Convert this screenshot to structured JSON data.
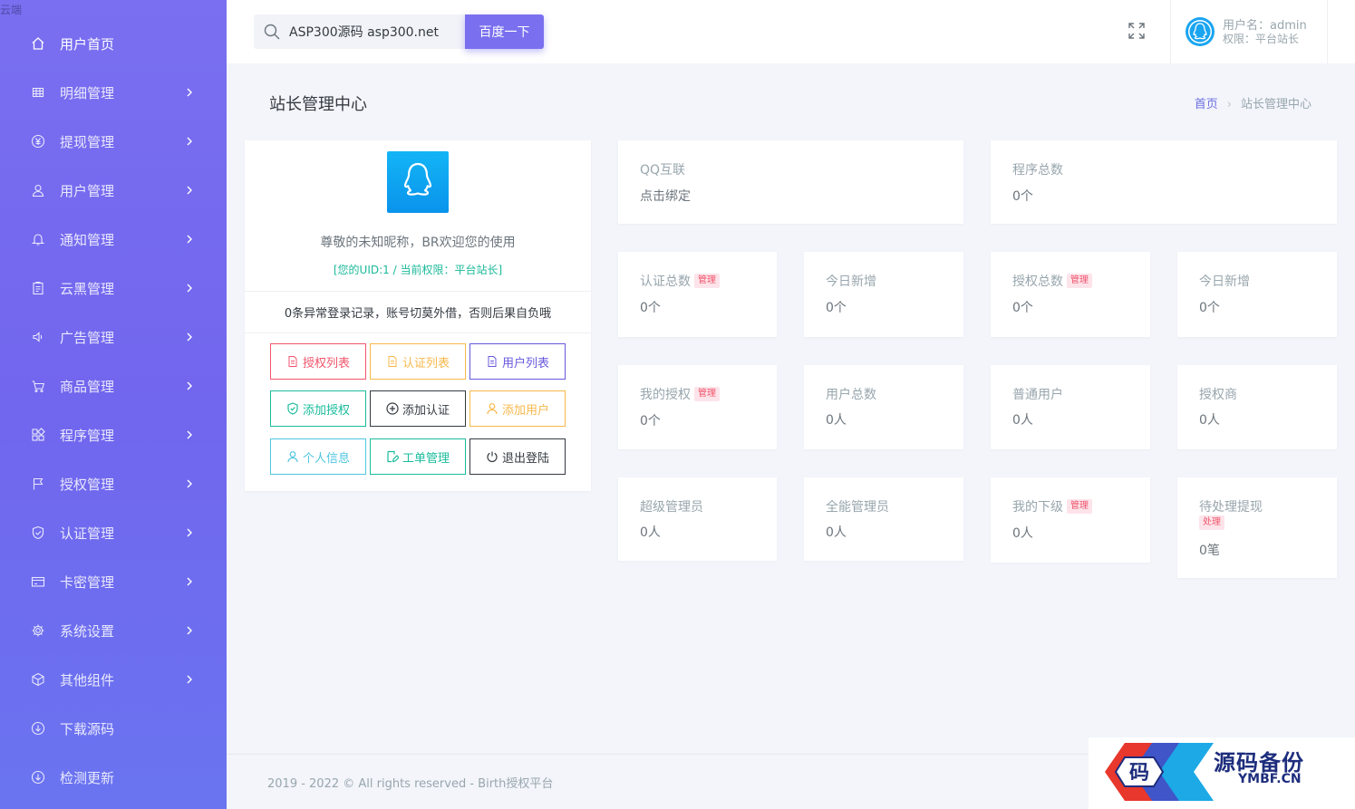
{
  "site_name": "云端",
  "sidebar": {
    "items": [
      {
        "label": "用户首页",
        "icon": "home-icon"
      },
      {
        "label": "明细管理",
        "icon": "grid-icon"
      },
      {
        "label": "提现管理",
        "icon": "yen-icon"
      },
      {
        "label": "用户管理",
        "icon": "user-icon"
      },
      {
        "label": "通知管理",
        "icon": "bell-icon"
      },
      {
        "label": "云黑管理",
        "icon": "clipboard-icon"
      },
      {
        "label": "广告管理",
        "icon": "speaker-icon"
      },
      {
        "label": "商品管理",
        "icon": "cart-icon"
      },
      {
        "label": "程序管理",
        "icon": "apps-icon"
      },
      {
        "label": "授权管理",
        "icon": "flag-icon"
      },
      {
        "label": "认证管理",
        "icon": "shield-icon"
      },
      {
        "label": "卡密管理",
        "icon": "card-icon"
      },
      {
        "label": "系统设置",
        "icon": "gear-icon"
      },
      {
        "label": "其他组件",
        "icon": "cube-icon"
      },
      {
        "label": "下载源码",
        "icon": "download-icon"
      },
      {
        "label": "检测更新",
        "icon": "update-icon"
      }
    ]
  },
  "search": {
    "value": "ASP300源码  asp300.net",
    "button": "百度一下"
  },
  "user": {
    "name": "用户名：admin",
    "role": "权限：平台站长"
  },
  "page": {
    "title": "站长管理中心",
    "breadcrumb_home": "首页",
    "breadcrumb_current": "站长管理中心"
  },
  "profile": {
    "welcome": "尊敬的未知昵称，BR欢迎您的使用",
    "uid_line": "[您的UID:1 / 当前权限：平台站长]",
    "warning": "0条异常登录记录，账号切莫外借，否则后果自负哦",
    "buttons": [
      {
        "label": "授权列表",
        "color": "#f1556c",
        "icon": "document-icon"
      },
      {
        "label": "认证列表",
        "color": "#f7b84b",
        "icon": "document-icon"
      },
      {
        "label": "用户列表",
        "color": "#6658dd",
        "icon": "document-icon"
      },
      {
        "label": "添加授权",
        "color": "#1abc9c",
        "icon": "shield-check-icon"
      },
      {
        "label": "添加认证",
        "color": "#343a40",
        "icon": "plus-circle-icon"
      },
      {
        "label": "添加用户",
        "color": "#f7b84b",
        "icon": "user-icon"
      },
      {
        "label": "个人信息",
        "color": "#4fc6e1",
        "icon": "user-icon"
      },
      {
        "label": "工单管理",
        "color": "#1abc9c",
        "icon": "edit-icon"
      },
      {
        "label": "退出登陆",
        "color": "#343a40",
        "icon": "power-icon"
      }
    ]
  },
  "stats": {
    "qq": {
      "label": "QQ互联",
      "value": "点击绑定"
    },
    "programs": {
      "label": "程序总数",
      "value": "0个"
    },
    "cards": [
      {
        "label": "认证总数",
        "badge": "管理",
        "value": "0个"
      },
      {
        "label": "今日新增",
        "badge": "",
        "value": "0个"
      },
      {
        "label": "授权总数",
        "badge": "管理",
        "value": "0个"
      },
      {
        "label": "今日新增",
        "badge": "",
        "value": "0个"
      },
      {
        "label": "我的授权",
        "badge": "管理",
        "value": "0个"
      },
      {
        "label": "用户总数",
        "badge": "",
        "value": "0人"
      },
      {
        "label": "普通用户",
        "badge": "",
        "value": "0人"
      },
      {
        "label": "授权商",
        "badge": "",
        "value": "0人"
      },
      {
        "label": "超级管理员",
        "badge": "",
        "value": "0人"
      },
      {
        "label": "全能管理员",
        "badge": "",
        "value": "0人"
      },
      {
        "label": "我的下级",
        "badge": "管理",
        "value": "0人"
      },
      {
        "label": "待处理提现",
        "badge": "处理",
        "value": "0笔"
      }
    ]
  },
  "footer": "2019 - 2022 © All rights reserved - Birth授权平台",
  "watermark": {
    "title": "源码备份",
    "sub": "YMBF.CN",
    "logo_char": "码"
  }
}
